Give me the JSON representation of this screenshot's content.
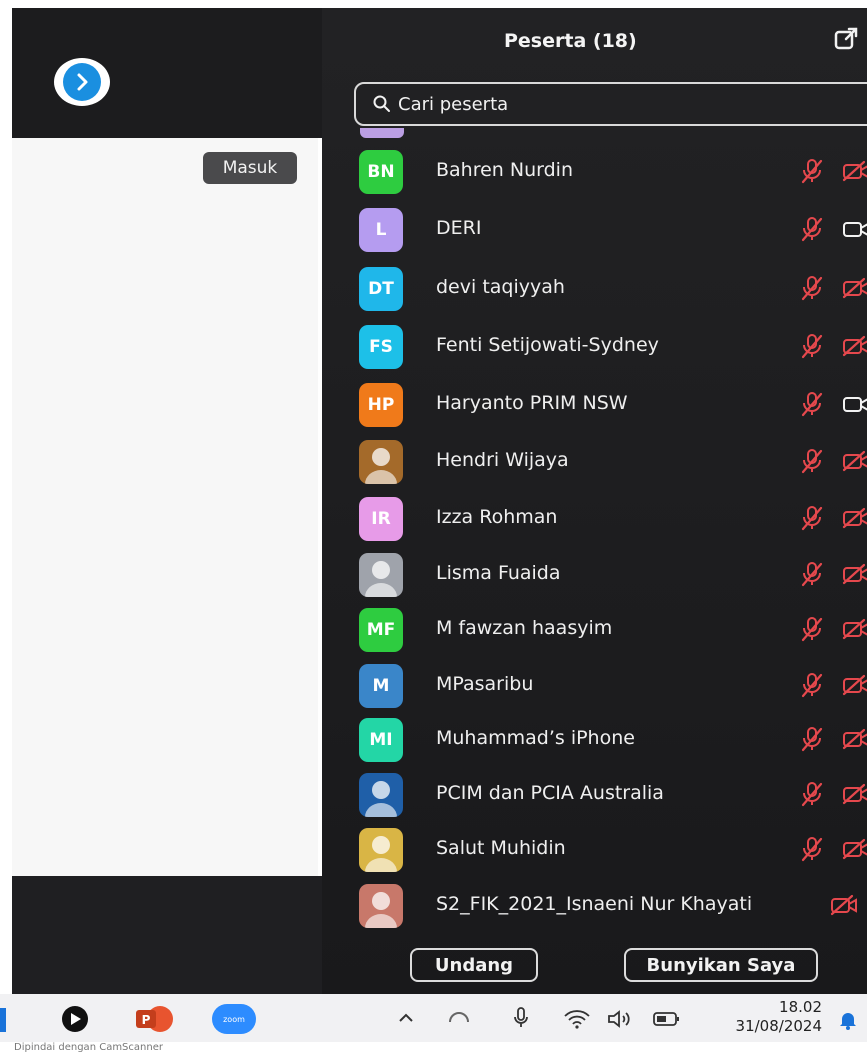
{
  "panel": {
    "title": "Peserta (18)",
    "search_placeholder": "Cari peserta",
    "invite_label": "Undang",
    "unmute_label": "Bunyikan Saya"
  },
  "left": {
    "enter_label": "Masuk"
  },
  "participants": [
    {
      "name": "Bahren Nurdin",
      "initials": "BN",
      "color": "#2ecc40",
      "mic": "muted",
      "cam": "off"
    },
    {
      "name": "DERI",
      "initials": "L",
      "color": "#b59cf0",
      "mic": "muted",
      "cam": "on"
    },
    {
      "name": "devi taqiyyah",
      "initials": "DT",
      "color": "#1fb7ea",
      "mic": "muted",
      "cam": "off"
    },
    {
      "name": "Fenti Setijowati-Sydney",
      "initials": "FS",
      "color": "#1dc0e8",
      "mic": "muted",
      "cam": "off"
    },
    {
      "name": "Haryanto PRIM NSW",
      "initials": "HP",
      "color": "#f07a1a",
      "mic": "muted",
      "cam": "on"
    },
    {
      "name": "Hendri Wijaya",
      "initials": "",
      "color": "#a46a2a",
      "mic": "muted",
      "cam": "off"
    },
    {
      "name": "Izza Rohman",
      "initials": "IR",
      "color": "#e79be8",
      "mic": "muted",
      "cam": "off"
    },
    {
      "name": "Lisma Fuaida",
      "initials": "",
      "color": "#9fa3ab",
      "mic": "muted",
      "cam": "off"
    },
    {
      "name": "M fawzan haasyim",
      "initials": "MF",
      "color": "#2ecc40",
      "mic": "muted",
      "cam": "off"
    },
    {
      "name": "MPasaribu",
      "initials": "M",
      "color": "#3a86c9",
      "mic": "muted",
      "cam": "off"
    },
    {
      "name": "Muhammad’s iPhone",
      "initials": "MI",
      "color": "#23d6a6",
      "mic": "muted",
      "cam": "off"
    },
    {
      "name": "PCIM dan PCIA Australia",
      "initials": "",
      "color": "#1f5fa8",
      "mic": "muted",
      "cam": "off"
    },
    {
      "name": "Salut Muhidin",
      "initials": "",
      "color": "#d9b545",
      "mic": "muted",
      "cam": "off"
    },
    {
      "name": "S2_FIK_2021_Isnaeni Nur Khayati",
      "initials": "",
      "color": "#c8786a",
      "mic": "none",
      "cam": "off"
    }
  ],
  "taskbar": {
    "time": "18.02",
    "date": "31/08/2024",
    "zoom_label": "zoom"
  },
  "footer": {
    "scanner_text": "Dipindai dengan CamScanner"
  },
  "colors": {
    "panel_bg": "#1f1f21",
    "muted_red": "#e5484d",
    "accent_blue": "#1a8fe0"
  }
}
